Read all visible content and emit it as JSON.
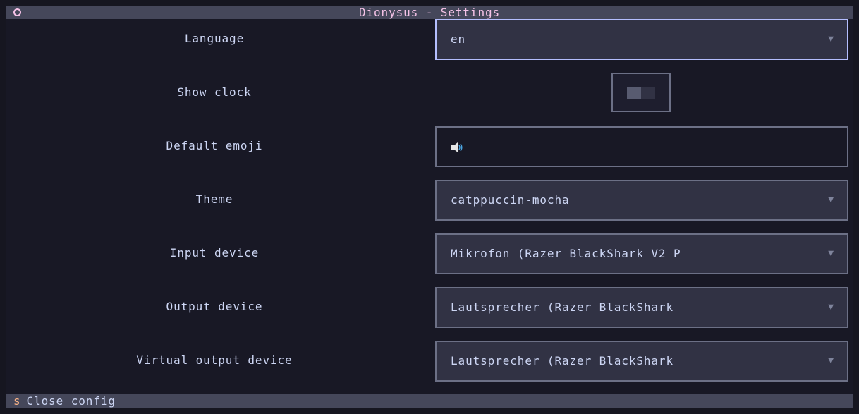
{
  "window": {
    "title": "Dionysus - Settings"
  },
  "settings": {
    "language": {
      "label": "Language",
      "value": "en"
    },
    "show_clock": {
      "label": "Show clock",
      "value": false
    },
    "default_emoji": {
      "label": "Default emoji",
      "value": "🔊",
      "icon": "speaker-icon"
    },
    "theme": {
      "label": "Theme",
      "value": "catppuccin-mocha"
    },
    "input_device": {
      "label": "Input device",
      "value": "Mikrofon (Razer BlackShark V2 P"
    },
    "output_device": {
      "label": "Output device",
      "value": "Lautsprecher (Razer BlackShark"
    },
    "virtual_output_device": {
      "label": "Virtual output device",
      "value": "Lautsprecher (Razer BlackShark"
    }
  },
  "footer": {
    "key": "s",
    "label": "Close config"
  },
  "colors": {
    "background": "#181825",
    "titlebar": "#45475a",
    "title_text": "#f5c2e7",
    "focus_border": "#b4befe",
    "footer_key": "#fab387"
  }
}
